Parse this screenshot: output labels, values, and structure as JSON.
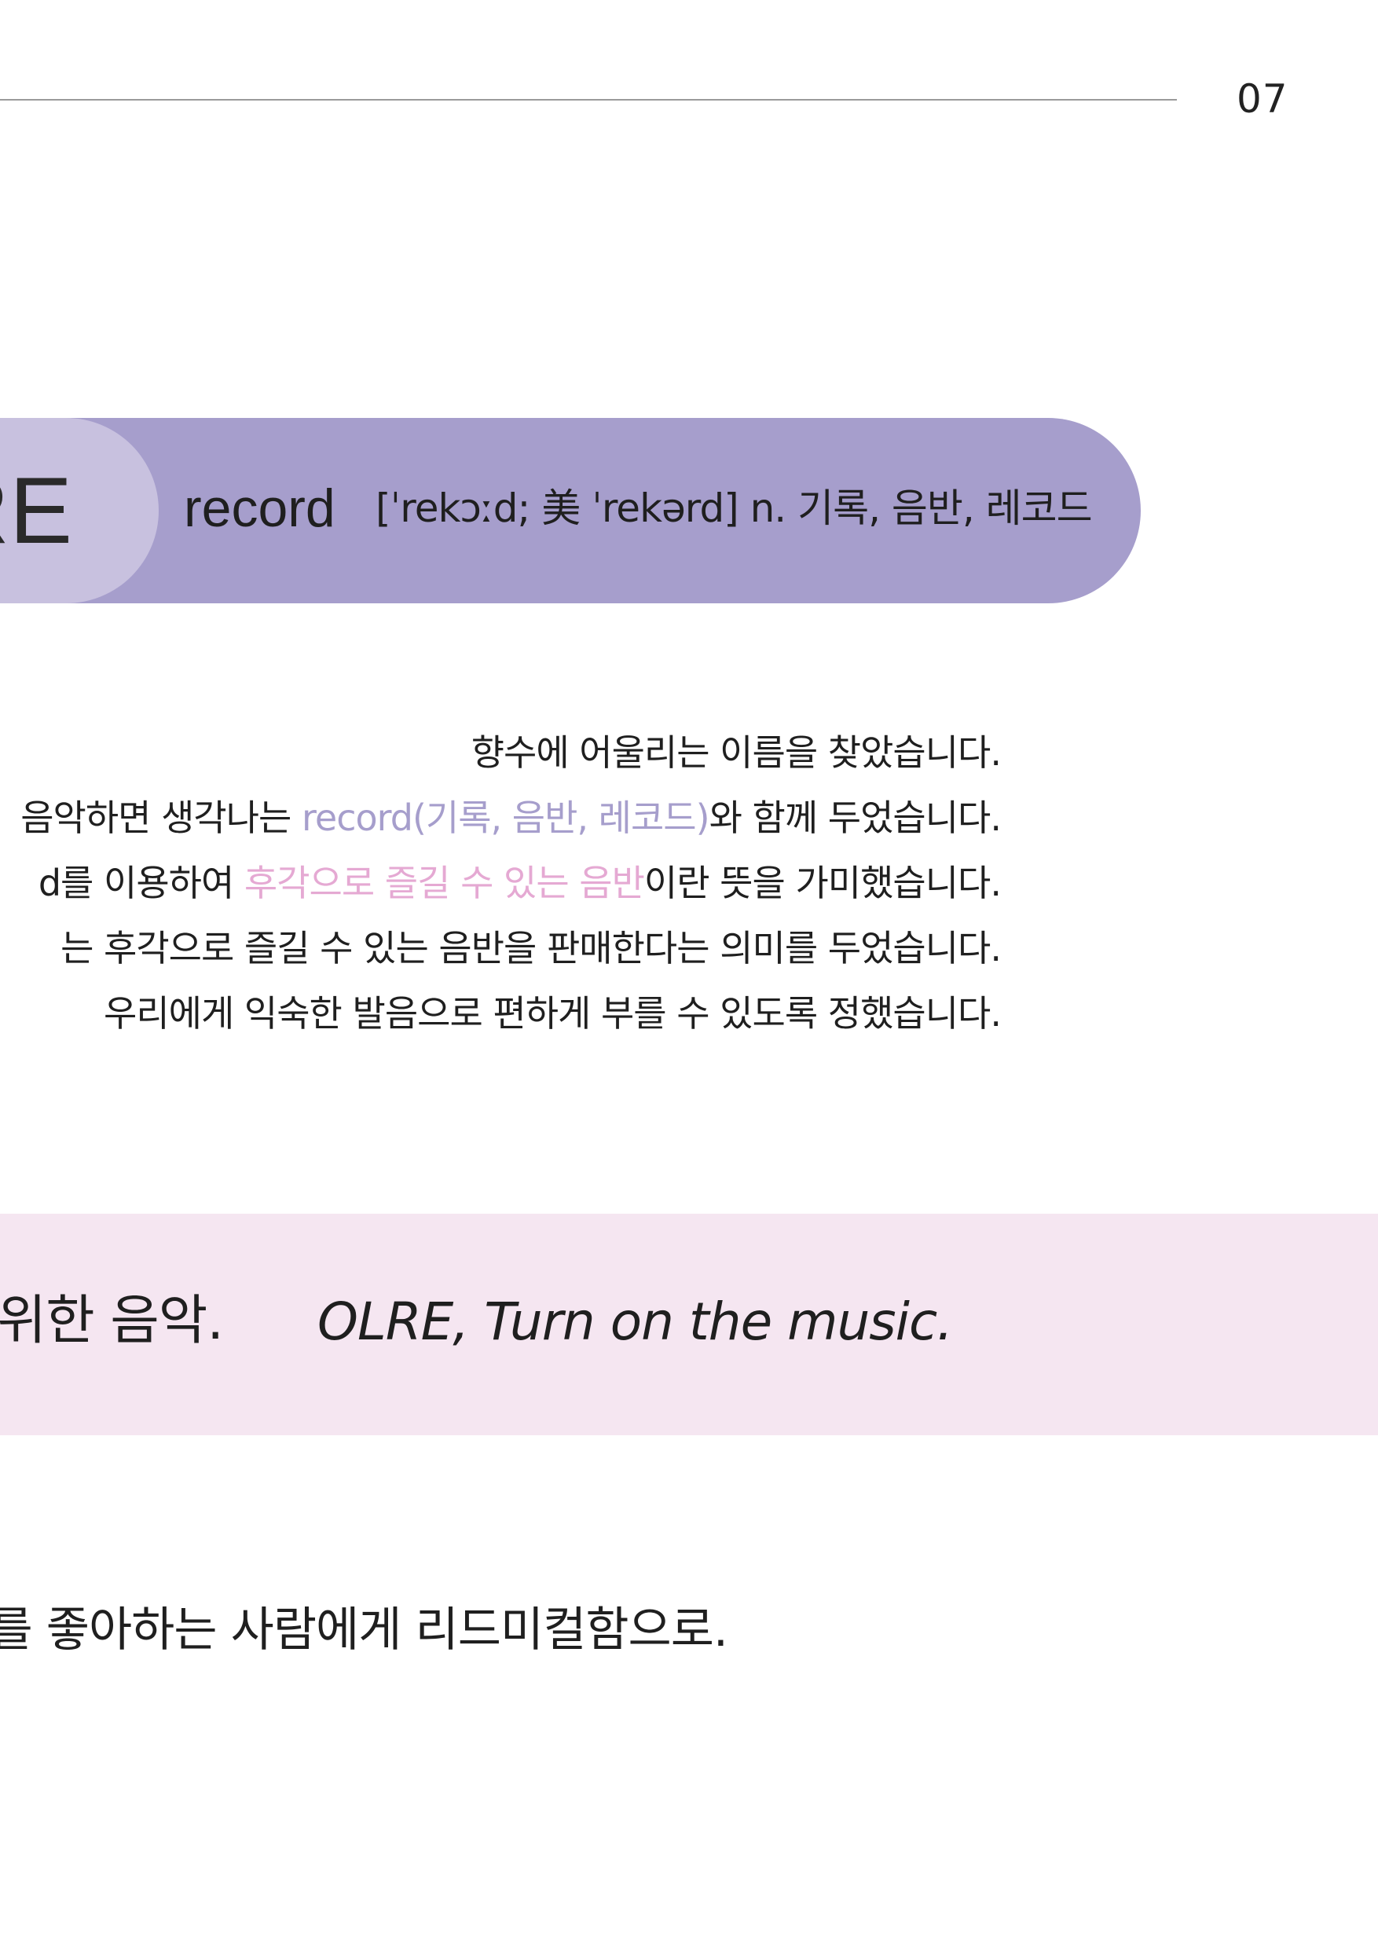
{
  "page": {
    "number": "07"
  },
  "brand": {
    "logo_fragment": "RE"
  },
  "definition": {
    "word": "record",
    "pronunciation_and_meaning": "[ˈrekɔːd; 美 ˈrekərd] n. 기록, 음반, 레코드"
  },
  "body": {
    "line1": "향수에 어울리는 이름을 찾았습니다.",
    "line2": {
      "before": "음악하면 생각나는 ",
      "highlight": "record(기록, 음반, 레코드)",
      "after": "와 함께 두었습니다."
    },
    "line3": {
      "before": "d를 이용하여 ",
      "highlight": "후각으로 즐길 수 있는 음반",
      "after": "이란 뜻을 가미했습니다."
    },
    "line4": "는 후각으로 즐길 수 있는 음반을 판매한다는 의미를 두었습니다.",
    "line5": " 우리에게 익숙한 발음으로 편하게 부를 수 있도록 정했습니다."
  },
  "slogan": {
    "korean": "위한 음악.",
    "english": "OLRE, Turn on the music."
  },
  "closing": {
    "text": "를 좋아하는 사람에게 리드미컬함으로."
  },
  "colors": {
    "pill_main": "#a69ecc",
    "pill_logo": "#c8c1df",
    "highlight_purple": "#a69ecc",
    "highlight_pink": "#e5a9d3",
    "slogan_band": "#f5e6f1",
    "rule": "#9a9a9a"
  }
}
